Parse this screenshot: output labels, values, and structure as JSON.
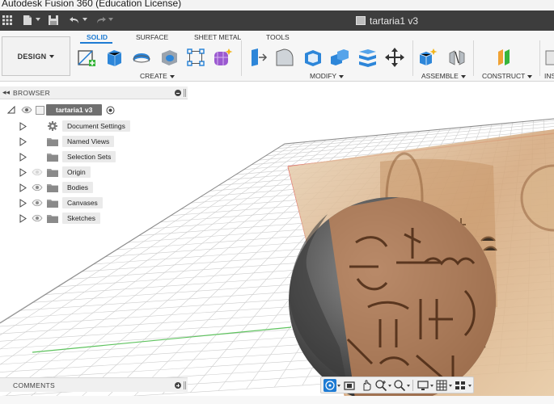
{
  "window": {
    "title": "Autodesk Fusion 360 (Education License)"
  },
  "document_tab": {
    "name": "tartaria1 v3"
  },
  "ribbon": {
    "workspace_button": "DESIGN",
    "tabs": [
      "SOLID",
      "SURFACE",
      "SHEET METAL",
      "TOOLS"
    ],
    "active_tab": "SOLID",
    "groups": [
      "CREATE",
      "MODIFY",
      "ASSEMBLE",
      "CONSTRUCT",
      "INS"
    ]
  },
  "browser": {
    "title": "BROWSER",
    "root": "tartaria1 v3",
    "items": [
      {
        "label": "Document Settings",
        "icon": "gear-icon"
      },
      {
        "label": "Named Views",
        "icon": "folder-icon"
      },
      {
        "label": "Selection Sets",
        "icon": "folder-icon"
      },
      {
        "label": "Origin",
        "icon": "folder-icon",
        "visibility": "hidden"
      },
      {
        "label": "Bodies",
        "icon": "folder-icon",
        "visibility": "visible"
      },
      {
        "label": "Canvases",
        "icon": "folder-icon",
        "visibility": "visible"
      },
      {
        "label": "Sketches",
        "icon": "folder-icon",
        "visibility": "visible"
      }
    ]
  },
  "comments": {
    "title": "COMMENTS"
  },
  "colors": {
    "accent": "#1e7bd3",
    "titlebar": "#f3f3f3",
    "quick_access_bar": "#3d3d3d",
    "ribbon": "#f6f6f6",
    "grid_line": "#c8c8c8",
    "x_axis": "#e25050",
    "z_axis": "#5fc35f"
  },
  "navbar": {
    "icons": [
      "orbit-icon",
      "look-at-icon",
      "pan-icon",
      "zoom-icon",
      "fit-icon",
      "display-settings-icon",
      "grid-settings-icon",
      "viewports-icon"
    ]
  }
}
